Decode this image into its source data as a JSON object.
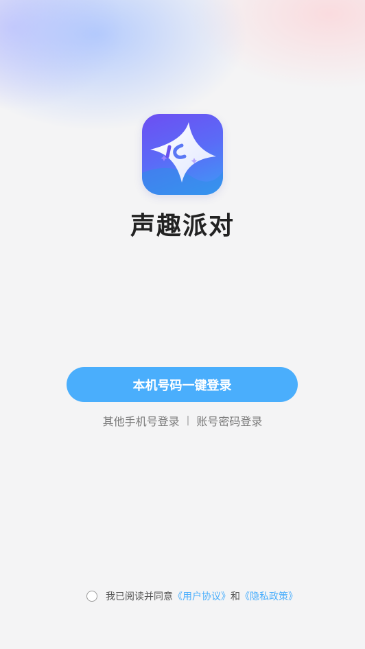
{
  "app": {
    "name": "声趣派对"
  },
  "login": {
    "primary_button": "本机号码一键登录",
    "other_phone_link": "其他手机号登录",
    "divider": "|",
    "password_login_link": "账号密码登录"
  },
  "agreement": {
    "text": "我已阅读并同意",
    "user_agreement": "《用户协议》",
    "and": "和",
    "privacy_policy": "《隐私政策》",
    "checked": false
  },
  "icons": {
    "logo": "app-logo-star-icon",
    "checkbox": "radio-unchecked-icon"
  },
  "colors": {
    "primary": "#4aaefc",
    "link": "#4aaefc",
    "title": "#222222",
    "secondary_text": "#7a7a7a",
    "background": "#f4f4f5"
  }
}
